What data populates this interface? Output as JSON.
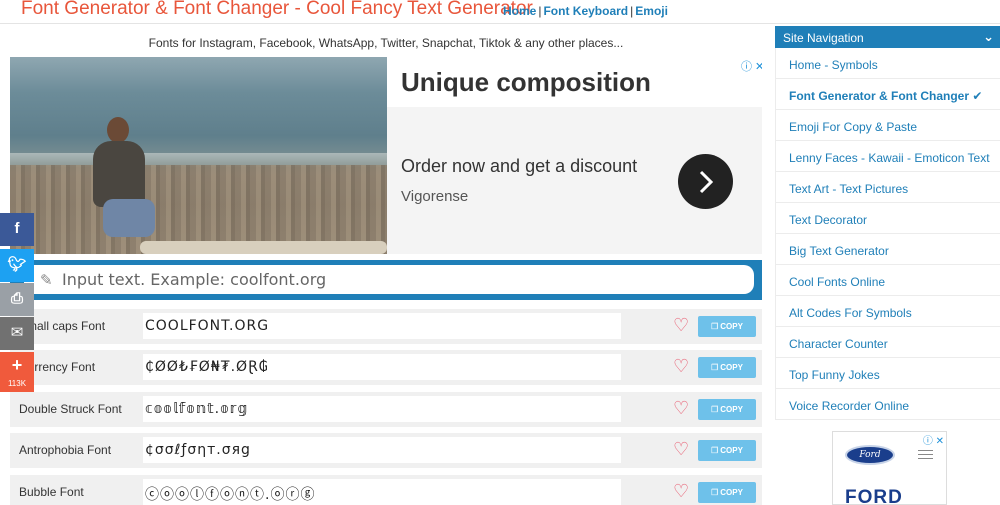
{
  "header": {
    "site_title": "Font Generator & Font Changer - Cool Fancy Text Generator",
    "links": [
      "Home",
      "Font Keyboard",
      "Emoji"
    ],
    "separator": "|"
  },
  "tagline": "Fonts for Instagram, Facebook, WhatsApp, Twitter, Snapchat, Tiktok & any other places...",
  "ad": {
    "headline": "Unique composition",
    "offer": "Order now and get a discount",
    "brand": "Vigorense",
    "choices": "ⓘ ✕"
  },
  "input": {
    "placeholder": "Input text. Example: coolfont.org",
    "icon": "pencil-icon"
  },
  "font_rows": [
    {
      "name": "Small caps Font",
      "sample": "COOLFONT.ORG",
      "copy_label": "COPY"
    },
    {
      "name": "Currency Font",
      "sample": "₵ØØ₺₣Ø₦₮.ØⱤ₲",
      "copy_label": "COPY"
    },
    {
      "name": "Double Struck Font",
      "sample": "𝕔𝕠𝕠𝕝𝕗𝕠𝕟𝕥.𝕠𝕣𝕘",
      "copy_label": "COPY"
    },
    {
      "name": "Antrophobia Font",
      "sample": "¢σσℓƒσηт.σяg",
      "copy_label": "COPY"
    },
    {
      "name": "Bubble Font",
      "sample": "ⓒⓞⓞⓛⓕⓞⓝⓣ.ⓞⓡⓖ",
      "copy_label": "COPY"
    }
  ],
  "share": {
    "buttons": [
      "facebook-icon",
      "twitter-icon",
      "print-icon",
      "email-icon",
      "more-icon"
    ],
    "count": "113K"
  },
  "sidebar": {
    "title": "Site Navigation",
    "items": [
      {
        "label": "Home - Symbols",
        "active": false
      },
      {
        "label": "Font Generator & Font Changer ✔",
        "active": true
      },
      {
        "label": "Emoji For Copy & Paste",
        "active": false
      },
      {
        "label": "Lenny Faces - Kawaii - Emoticon Text",
        "active": false
      },
      {
        "label": "Text Art - Text Pictures",
        "active": false
      },
      {
        "label": "Text Decorator",
        "active": false
      },
      {
        "label": "Big Text Generator",
        "active": false
      },
      {
        "label": "Cool Fonts Online",
        "active": false
      },
      {
        "label": "Alt Codes For Symbols",
        "active": false
      },
      {
        "label": "Character Counter",
        "active": false
      },
      {
        "label": "Top Funny Jokes",
        "active": false
      },
      {
        "label": "Voice Recorder Online",
        "active": false
      }
    ]
  },
  "side_ad": {
    "logo_text": "Ford",
    "brand": "FORD",
    "choices": "ⓘ ✕"
  },
  "colors": {
    "title_red": "#e8563b",
    "link_blue": "#1f7fb8",
    "copy_button": "#6ec1ea",
    "heart": "#e8566b",
    "row_bg": "#f0f0f0"
  }
}
